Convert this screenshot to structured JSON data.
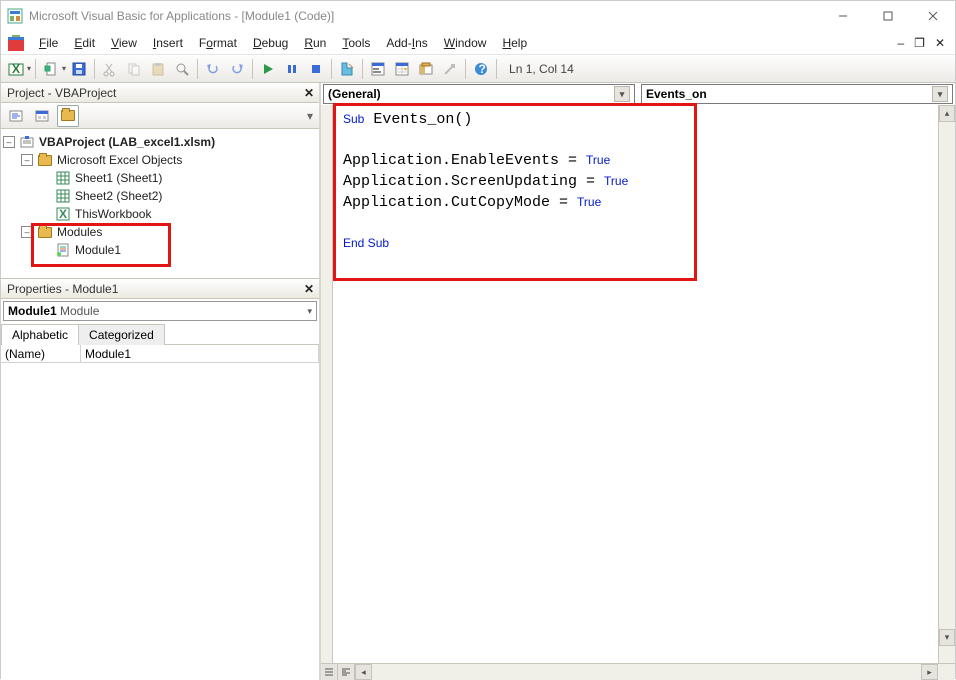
{
  "title": "Microsoft Visual Basic for Applications - [Module1 (Code)]",
  "menubar": [
    "File",
    "Edit",
    "View",
    "Insert",
    "Format",
    "Debug",
    "Run",
    "Tools",
    "Add-Ins",
    "Window",
    "Help"
  ],
  "menubar_accel": [
    0,
    0,
    0,
    0,
    1,
    0,
    0,
    0,
    4,
    0,
    0
  ],
  "cursor_status": "Ln 1, Col 14",
  "project_panel": {
    "title": "Project - VBAProject",
    "root": "VBAProject (LAB_excel1.xlsm)",
    "excel_objects_folder": "Microsoft Excel Objects",
    "sheets": [
      "Sheet1 (Sheet1)",
      "Sheet2 (Sheet2)",
      "ThisWorkbook"
    ],
    "modules_folder": "Modules",
    "module_name": "Module1"
  },
  "properties_panel": {
    "title": "Properties - Module1",
    "combo_label": "Module1",
    "combo_type": "Module",
    "tabs": [
      "Alphabetic",
      "Categorized"
    ],
    "rows": [
      {
        "name": "(Name)",
        "value": "Module1"
      }
    ]
  },
  "code_pane": {
    "object_dropdown": "(General)",
    "proc_dropdown": "Events_on",
    "lines": [
      {
        "t": "sub",
        "text": "Sub Events_on()"
      },
      {
        "t": "blank",
        "text": ""
      },
      {
        "t": "assign",
        "text": "Application.EnableEvents = True"
      },
      {
        "t": "assign",
        "text": "Application.ScreenUpdating = True"
      },
      {
        "t": "assign",
        "text": "Application.CutCopyMode = True"
      },
      {
        "t": "blank",
        "text": ""
      },
      {
        "t": "end",
        "text": "End Sub"
      }
    ]
  }
}
